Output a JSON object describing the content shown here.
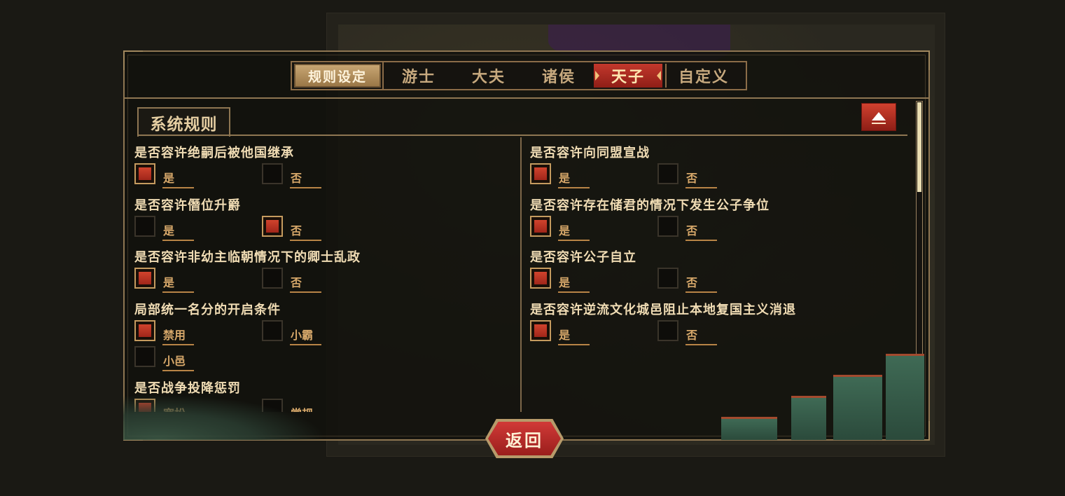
{
  "tabs": [
    {
      "label": "规则设定",
      "active": false
    },
    {
      "label": "游士",
      "active": false
    },
    {
      "label": "大夫",
      "active": false
    },
    {
      "label": "诸侯",
      "active": false
    },
    {
      "label": "天子",
      "active": true
    },
    {
      "label": "自定义",
      "active": false
    }
  ],
  "section": {
    "title": "系统规则"
  },
  "left_rules": [
    {
      "question": "是否容许绝嗣后被他国继承",
      "options": [
        {
          "label": "是",
          "checked": true
        },
        {
          "label": "否",
          "checked": false
        }
      ]
    },
    {
      "question": "是否容许僭位升爵",
      "options": [
        {
          "label": "是",
          "checked": false
        },
        {
          "label": "否",
          "checked": true
        }
      ]
    },
    {
      "question": "是否容许非幼主临朝情况下的卿士乱政",
      "options": [
        {
          "label": "是",
          "checked": true
        },
        {
          "label": "否",
          "checked": false
        }
      ]
    },
    {
      "question": "局部统一名分的开启条件",
      "options": [
        {
          "label": "禁用",
          "checked": true
        },
        {
          "label": "小霸",
          "checked": false
        },
        {
          "label": "小邑",
          "checked": false
        }
      ]
    },
    {
      "question": "是否战争投降惩罚",
      "options": [
        {
          "label": "宽松",
          "checked": true
        },
        {
          "label": "常规",
          "checked": false
        }
      ]
    }
  ],
  "right_rules": [
    {
      "question": "是否容许向同盟宣战",
      "options": [
        {
          "label": "是",
          "checked": true
        },
        {
          "label": "否",
          "checked": false
        }
      ]
    },
    {
      "question": "是否容许存在储君的情况下发生公子争位",
      "options": [
        {
          "label": "是",
          "checked": true
        },
        {
          "label": "否",
          "checked": false
        }
      ]
    },
    {
      "question": "是否容许公子自立",
      "options": [
        {
          "label": "是",
          "checked": true
        },
        {
          "label": "否",
          "checked": false
        }
      ]
    },
    {
      "question": "是否容许逆流文化城邑阻止本地复国主义消退",
      "options": [
        {
          "label": "是",
          "checked": true
        },
        {
          "label": "否",
          "checked": false
        }
      ]
    }
  ],
  "return_button": {
    "label": "返回"
  },
  "colors": {
    "accent_red": "#c3382c",
    "gold_border": "#8e7652",
    "text_gold": "#f0dcb4",
    "option_text": "#d7a86a"
  },
  "icons": {
    "collapse": "triangle-up-icon"
  }
}
